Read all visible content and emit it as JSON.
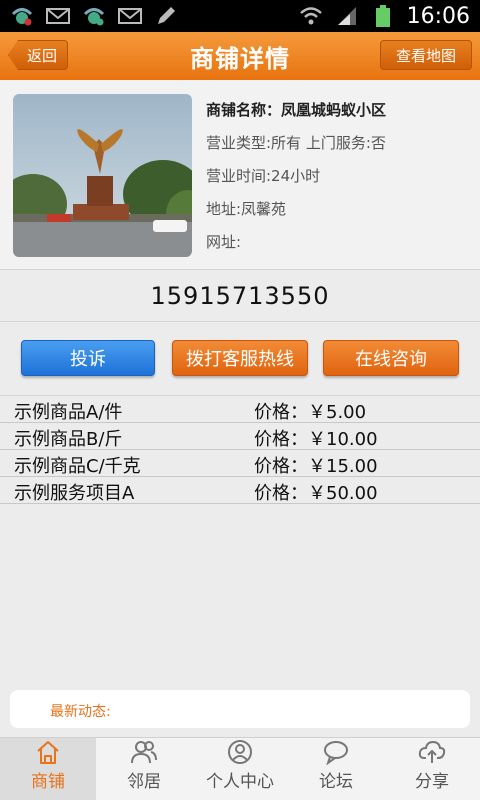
{
  "status_bar": {
    "time": "16:06",
    "icons": [
      "usb-debug-icon",
      "mail-icon",
      "usb-debug-icon",
      "mail-icon",
      "pen-icon",
      "wifi-icon",
      "signal-icon",
      "battery-icon"
    ]
  },
  "header": {
    "back_label": "返回",
    "title": "商铺详情",
    "map_label": "查看地图"
  },
  "shop": {
    "name": "商铺名称：凤凰城蚂蚁小区",
    "type": "营业类型:所有 上门服务:否",
    "hours": "营业时间:24小时",
    "address": "地址:凤馨苑",
    "website": "网址:"
  },
  "phone": "15915713550",
  "actions": {
    "complain": "投诉",
    "hotline": "拨打客服热线",
    "consult": "在线咨询"
  },
  "products": [
    {
      "name": "示例商品A/件",
      "price": "价格：￥5.00"
    },
    {
      "name": "示例商品B/斤",
      "price": "价格：￥10.00"
    },
    {
      "name": "示例商品C/千克",
      "price": "价格：￥15.00"
    },
    {
      "name": "示例服务项目A",
      "price": "价格：￥50.00"
    }
  ],
  "news": {
    "label": "最新动态:"
  },
  "nav": [
    {
      "label": "商铺",
      "icon": "home-icon",
      "active": true
    },
    {
      "label": "邻居",
      "icon": "people-icon",
      "active": false
    },
    {
      "label": "个人中心",
      "icon": "user-icon",
      "active": false
    },
    {
      "label": "论坛",
      "icon": "chat-icon",
      "active": false
    },
    {
      "label": "分享",
      "icon": "cloud-upload-icon",
      "active": false
    }
  ],
  "colors": {
    "accent": "#f08520",
    "complain_button": "#2b84e4",
    "news_label": "#e8731a"
  }
}
